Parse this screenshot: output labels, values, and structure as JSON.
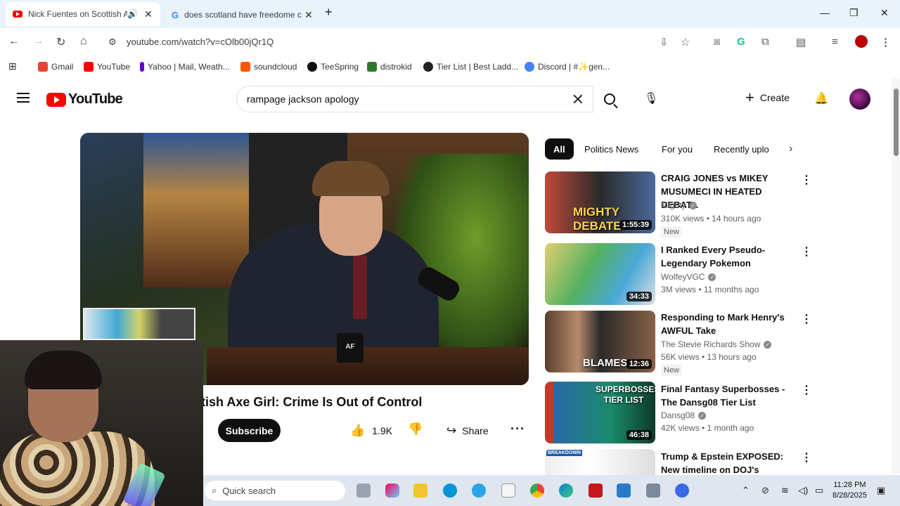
{
  "browser": {
    "tabs": [
      {
        "title": "Nick Fuentes on Scottish A",
        "active": true,
        "icon": "youtube-favicon"
      },
      {
        "title": "does scotland have freedome c",
        "active": false,
        "icon": "google-favicon"
      }
    ],
    "new_tab": "+",
    "url": "youtube.com/watch?v=cOlb00jQr1Q",
    "window_controls": {
      "minimize": "—",
      "maximize": "❐",
      "close": "✕"
    }
  },
  "bookmarks": [
    {
      "label": "Gmail",
      "color": "#ea4335"
    },
    {
      "label": "YouTube",
      "color": "#ff0000"
    },
    {
      "label": "Yahoo | Mail, Weath...",
      "color": "#6001d2"
    },
    {
      "label": "soundcloud",
      "color": "#ff5500"
    },
    {
      "label": "TeeSpring",
      "color": "#111111"
    },
    {
      "label": "distrokid",
      "color": "#2b7a2b"
    },
    {
      "label": "Tier List | Best Ladd...",
      "color": "#222222"
    },
    {
      "label": "Discord | #✨gen...",
      "color": "#4285f4"
    }
  ],
  "youtube": {
    "logo_text": "YouTube",
    "search_value": "rampage jackson apology",
    "create_label": "Create",
    "video": {
      "title": "ttish Axe Girl: Crime Is Out of Control",
      "subscribe_label": "Subscribe",
      "likes": "1.9K",
      "share_label": "Share",
      "mug_text": "AF"
    },
    "chips": [
      "All",
      "Politics News",
      "For you",
      "Recently uplo"
    ],
    "related": [
      {
        "title": "CRAIG JONES vs MIKEY MUSUMECI IN HEATED DEBAT...",
        "channel": "Mighty",
        "verified": true,
        "meta": "310K views • 14 hours ago",
        "badge": "New",
        "duration": "1:55:39",
        "thumb_text": "MIGHTY DEBATE"
      },
      {
        "title": "I Ranked Every Pseudo-Legendary Pokemon",
        "channel": "WolfeyVGC",
        "verified": true,
        "meta": "3M views • 11 months ago",
        "badge": "",
        "duration": "34:33",
        "thumb_text": ""
      },
      {
        "title": "Responding to Mark Henry's AWFUL Take",
        "channel": "The Stevie Richards Show",
        "verified": true,
        "meta": "56K views • 13 hours ago",
        "badge": "New",
        "duration": "12:36",
        "thumb_text": "BLAMES V"
      },
      {
        "title": "Final Fantasy Superbosses - The Dansg08 Tier List",
        "channel": "Dansg08",
        "verified": true,
        "meta": "42K views • 1 month ago",
        "badge": "",
        "duration": "46:38",
        "thumb_text": "SUPERBOSSES TIER LIST"
      },
      {
        "title": "Trump & Epstein EXPOSED: New timeline on DOJ's secrets...",
        "channel": "",
        "verified": false,
        "meta": "",
        "badge": "",
        "duration": "",
        "thumb_text": "BREAKDOWN"
      }
    ]
  },
  "taskbar": {
    "search_placeholder": "Quick search",
    "time": "11:28 PM",
    "date": "8/28/2025"
  }
}
